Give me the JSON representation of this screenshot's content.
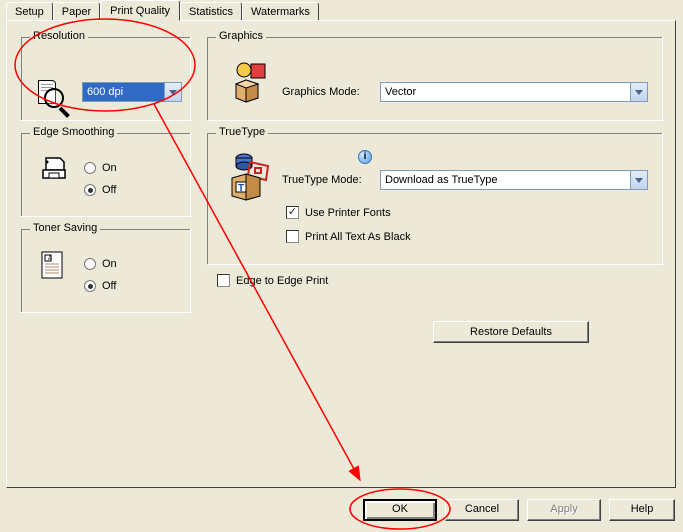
{
  "tabs": {
    "setup": "Setup",
    "paper": "Paper",
    "print_quality": "Print Quality",
    "statistics": "Statistics",
    "watermarks": "Watermarks"
  },
  "groups": {
    "resolution": "Resolution",
    "edge": "Edge Smoothing",
    "toner": "Toner Saving",
    "graphics": "Graphics",
    "truetype": "TrueType"
  },
  "resolution": {
    "value": "600 dpi"
  },
  "edge": {
    "on": "On",
    "off": "Off",
    "selected": "off"
  },
  "toner": {
    "on": "On",
    "off": "Off",
    "selected": "off"
  },
  "graphics": {
    "label": "Graphics Mode:",
    "value": "Vector"
  },
  "truetype": {
    "label": "TrueType Mode:",
    "value": "Download as TrueType",
    "use_printer_fonts": "Use Printer Fonts",
    "use_printer_fonts_checked": true,
    "print_black": "Print All Text As Black",
    "print_black_checked": false,
    "info": "i"
  },
  "edge_to_edge": {
    "label": "Edge to Edge Print",
    "checked": false
  },
  "buttons": {
    "restore": "Restore Defaults",
    "ok": "OK",
    "cancel": "Cancel",
    "apply": "Apply",
    "help": "Help"
  }
}
